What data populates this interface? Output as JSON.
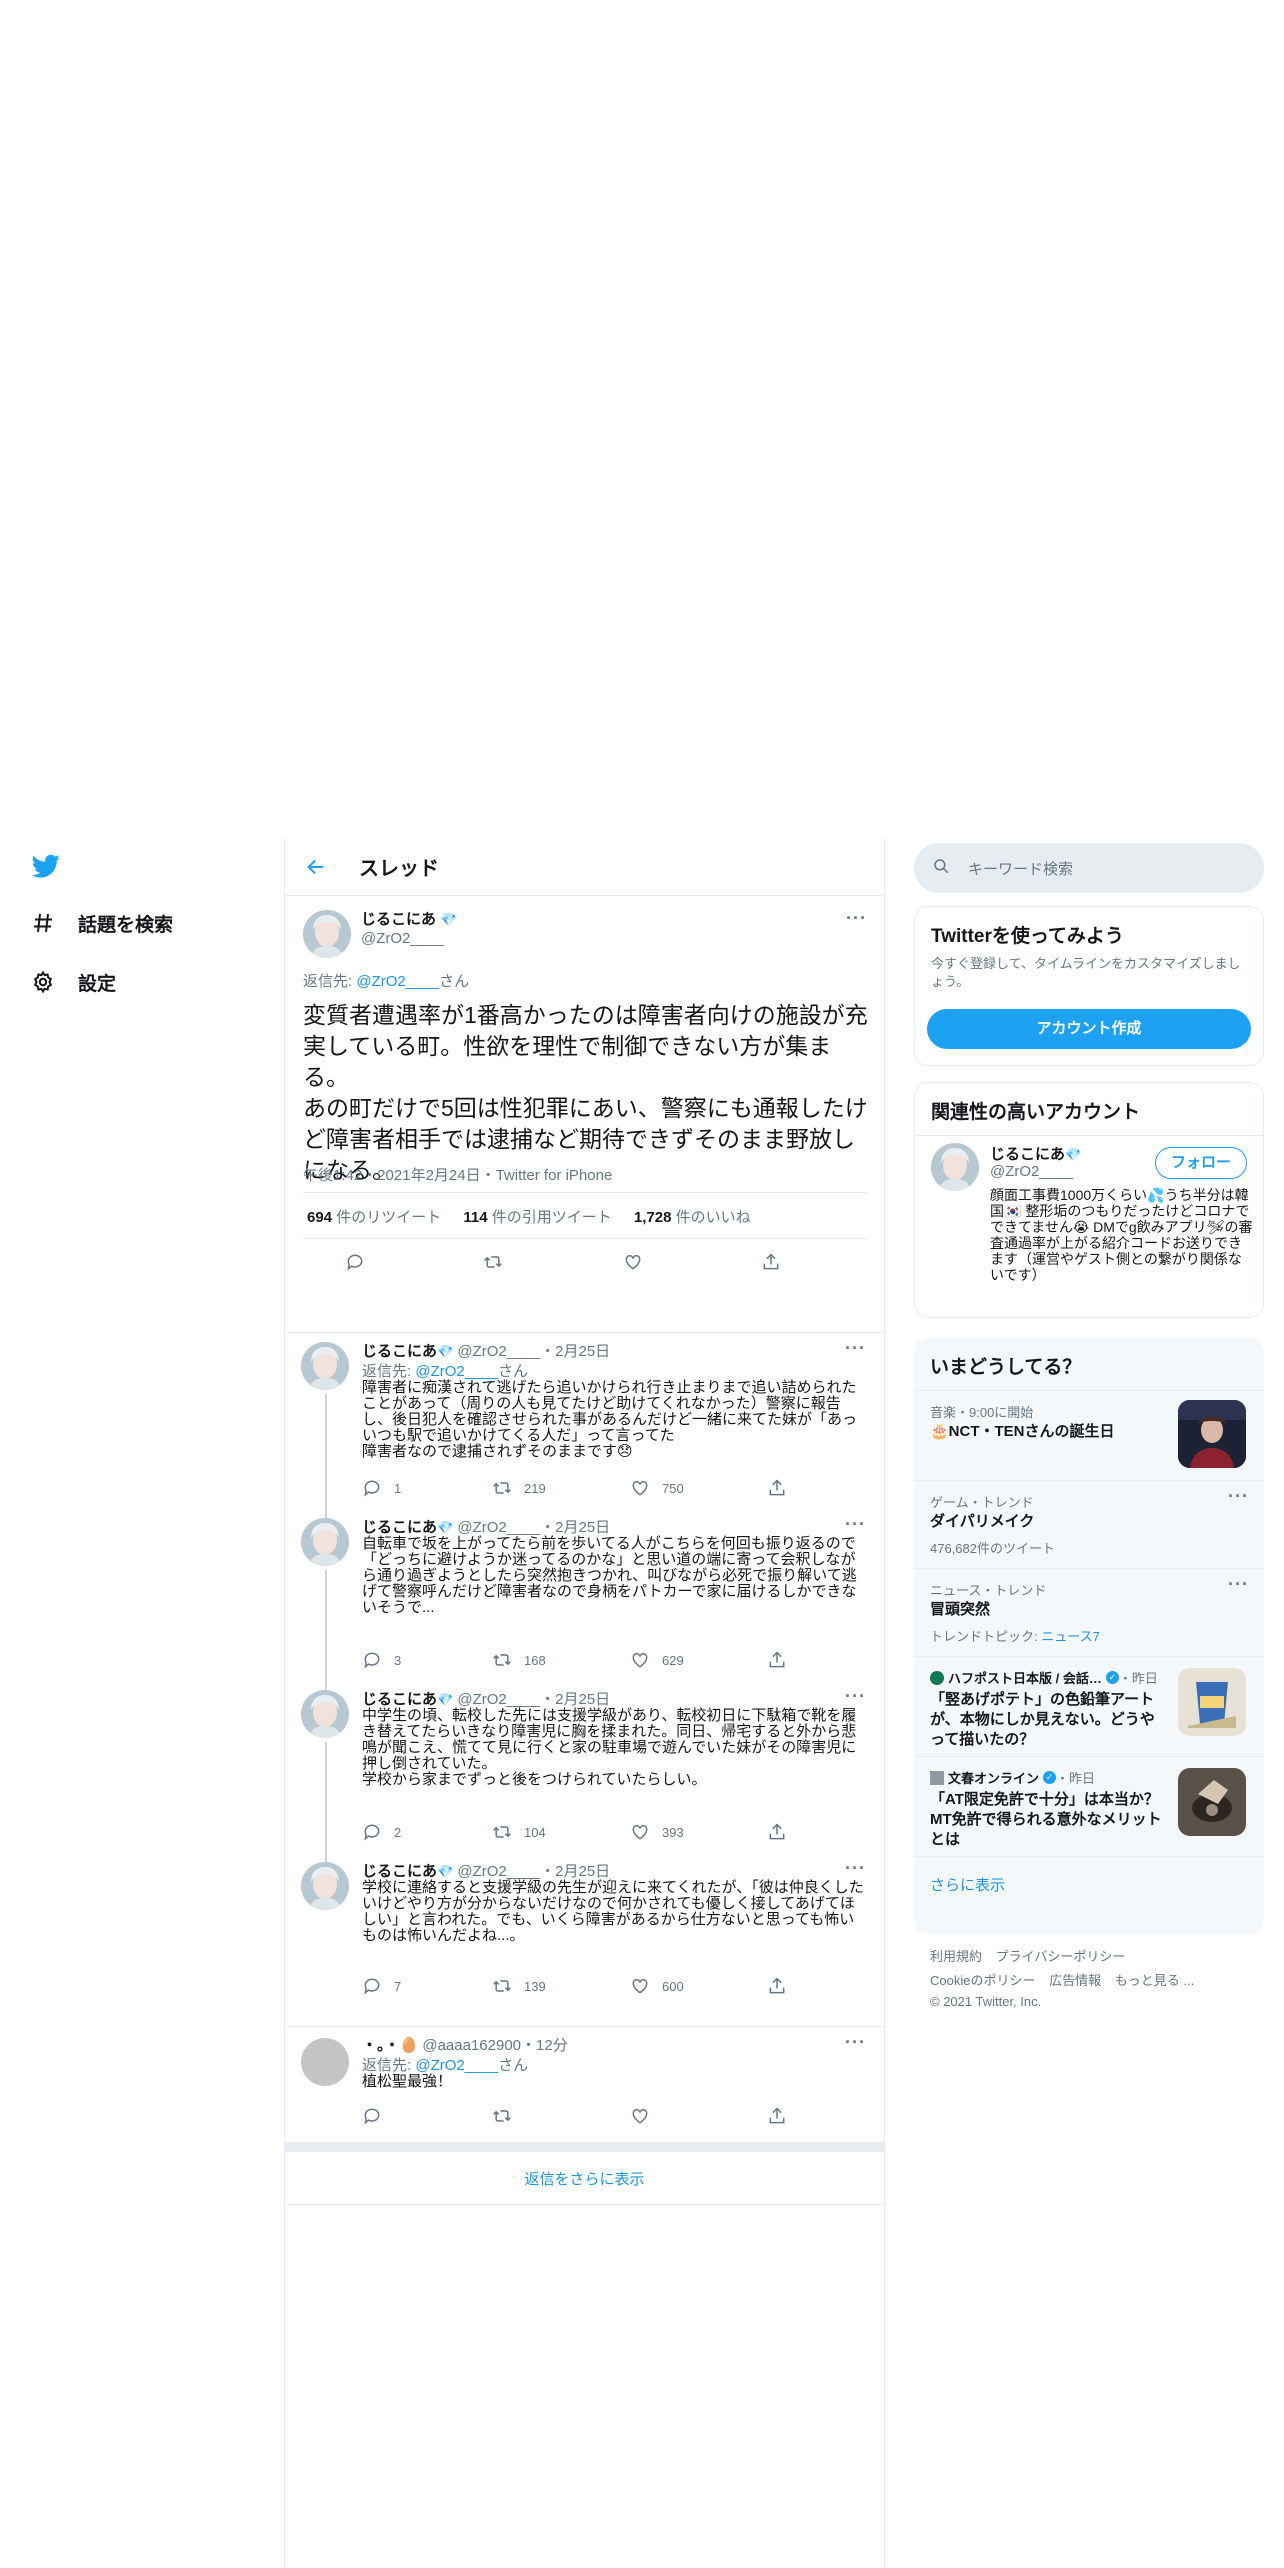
{
  "nav": {
    "explore": "話題を検索",
    "settings": "設定"
  },
  "header": {
    "title": "スレッド"
  },
  "main_tweet": {
    "name": "じるこにあ",
    "handle": "@ZrO2____",
    "reply_prefix": "返信先: ",
    "reply_to": "@ZrO2____",
    "reply_suffix": "さん",
    "text": "変質者遭遇率が1番高かったのは障害者向けの施設が充実している町。性欲を理性で制御できない方が集まる。\nあの町だけで5回は性犯罪にあい、警察にも通報したけど障害者相手では逮捕など期待できずそのまま野放しになる。",
    "time": "午後1:42・2021年2月24日・Twitter for iPhone",
    "retweets": "694",
    "retweets_label": "件のリツイート",
    "quotes": "114",
    "quotes_label": "件の引用ツイート",
    "likes": "1,728",
    "likes_label": "件のいいね"
  },
  "replies": [
    {
      "name": "じるこにあ",
      "handle": "@ZrO2____",
      "date": "・2月25日",
      "reply_prefix": "返信先: ",
      "reply_to": "@ZrO2____",
      "reply_suffix": "さん",
      "text": "障害者に痴漢されて逃げたら追いかけられ行き止まりまで追い詰められたことがあって（周りの人も見てたけど助けてくれなかった）警察に報告し、後日犯人を確認させられた事があるんだけど一緒に来てた妹が「あっいつも駅で追いかけてくる人だ」って言ってた\n障害者なので逮捕されずそのままです😞",
      "reply_count": "1",
      "retweet_count": "219",
      "like_count": "750"
    },
    {
      "name": "じるこにあ",
      "handle": "@ZrO2____",
      "date": "・2月25日",
      "text": "自転車で坂を上がってたら前を歩いてる人がこちらを何回も振り返るので「どっちに避けようか迷ってるのかな」と思い道の端に寄って会釈しながら通り過ぎようとしたら突然抱きつかれ、叫びながら必死で振り解いて逃げて警察呼んだけど障害者なので身柄をパトカーで家に届けるしかできないそうで...",
      "reply_count": "3",
      "retweet_count": "168",
      "like_count": "629"
    },
    {
      "name": "じるこにあ",
      "handle": "@ZrO2____",
      "date": "・2月25日",
      "text": "中学生の頃、転校した先には支援学級があり、転校初日に下駄箱で靴を履き替えてたらいきなり障害児に胸を揉まれた。同日、帰宅すると外から悲鳴が聞こえ、慌てて見に行くと家の駐車場で遊んでいた妹がその障害児に押し倒されていた。\n学校から家までずっと後をつけられていたらしい。",
      "reply_count": "2",
      "retweet_count": "104",
      "like_count": "393"
    },
    {
      "name": "じるこにあ",
      "handle": "@ZrO2____",
      "date": "・2月25日",
      "text": "学校に連絡すると支援学級の先生が迎えに来てくれたが、「彼は仲良くしたいけどやり方が分からないだけなので何かされても優しく接してあげてほしい」と言われた。でも、いくら障害があるから仕方ないと思っても怖いものは怖いんだよね...。",
      "reply_count": "7",
      "retweet_count": "139",
      "like_count": "600"
    }
  ],
  "other_reply": {
    "name": "・。・🥚",
    "handle": "@aaaa162900",
    "date": "・12分",
    "reply_prefix": "返信先: ",
    "reply_to": "@ZrO2____",
    "reply_suffix": "さん",
    "text": "植松聖最強！"
  },
  "show_more_replies": "返信をさらに表示",
  "search": {
    "placeholder": "キーワード検索"
  },
  "signup": {
    "title": "Twitterを使ってみよう",
    "body": "今すぐ登録して、タイムラインをカスタマイズしましょう。",
    "button": "アカウント作成"
  },
  "related": {
    "title": "関連性の高いアカウント",
    "name": "じるこにあ",
    "handle": "@ZrO2____",
    "follow": "フォロー",
    "bio": "顔面工事費1000万くらい💦うち半分は韓国🇰🇷 整形垢のつもりだったけどコロナでできてません😭 DMでg飲みアプリ🛩の審査通過率が上がる紹介コードお送りできます（運営やゲスト側との繋がり関係ないです）"
  },
  "trends": {
    "title": "いまどうしてる？",
    "items": [
      {
        "meta": "音楽・9:00に開始",
        "title": "🎂NCT・TENさんの誕生日"
      },
      {
        "meta": "ゲーム・トレンド",
        "title": "ダイパリメイク",
        "sub": "476,682件のツイート"
      },
      {
        "meta": "ニュース・トレンド",
        "title": "冒頭突然",
        "sub_prefix": "トレンドトピック: ",
        "sub_link": "ニュース7"
      },
      {
        "source": "ハフポスト日本版 / 会話…",
        "time": "・昨日",
        "title": "「竪あげポテト」の色鉛筆アートが、本物にしか見えない。どうやって描いたの？"
      },
      {
        "source": "文春オンライン",
        "time": "・昨日",
        "title": "「AT限定免許で十分」は本当か？　MT免許で得られる意外なメリットとは"
      }
    ],
    "show_more": "さらに表示"
  },
  "footer": {
    "line1": [
      "利用規約",
      "プライバシーポリシー"
    ],
    "line2": [
      "Cookieのポリシー",
      "広告情報",
      "もっと見る ..."
    ],
    "copyright": "© 2021 Twitter, Inc."
  },
  "colors": {
    "accent": "#1da1f2",
    "link": "#1b95e0",
    "muted": "#657786",
    "border": "#e6ecf0"
  }
}
